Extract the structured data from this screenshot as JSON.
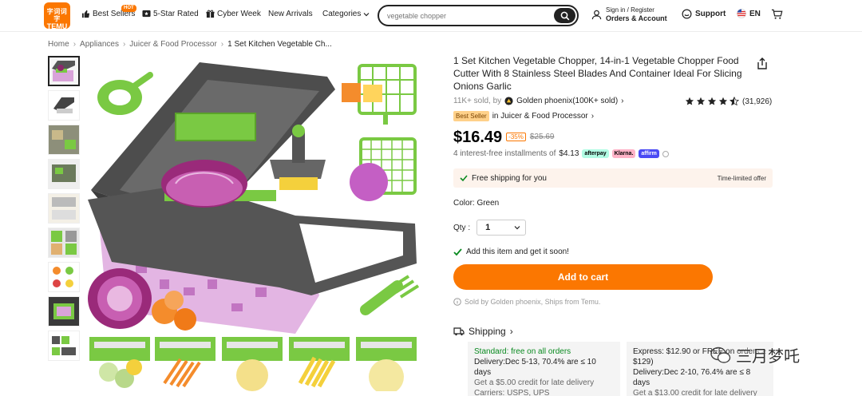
{
  "header": {
    "logo_line1": "字词词字",
    "logo_line2": "TEMU",
    "nav": {
      "best_sellers": "Best Sellers",
      "hot_badge": "HOT",
      "five_star": "5-Star Rated",
      "cyber_week": "Cyber Week",
      "new_arrivals": "New Arrivals",
      "categories": "Categories"
    },
    "search_placeholder": "vegetable chopper",
    "signin_line1": "Sign in / Register",
    "signin_line2": "Orders & Account",
    "support": "Support",
    "language": "EN"
  },
  "breadcrumb": {
    "home": "Home",
    "appliances": "Appliances",
    "juicer": "Juicer & Food Processor",
    "current": "1 Set Kitchen Vegetable Ch..."
  },
  "product": {
    "title": "1 Set Kitchen Vegetable Chopper, 14-in-1 Vegetable Chopper Food Cutter With 8 Stainless Steel Blades And Container Ideal For Slicing Onions Garlic",
    "sold": "11K+ sold, by",
    "seller": "Golden phoenix(100K+ sold)",
    "rating_count": "(31,926)",
    "rating_value": 4.7,
    "best_seller_badge": "Best Seller",
    "best_seller_category": "in Juicer & Food Processor",
    "price": "$16.49",
    "discount": "-35%",
    "old_price": "$25.69",
    "installments_text": "4 interest-free installments of",
    "installment_amount": "$4.13",
    "afterpay": "afterpay",
    "klarna": "Klarna.",
    "affirm": "affirm",
    "free_shipping": "Free shipping for you",
    "time_limited": "Time-limited offer",
    "color_label": "Color: Green",
    "qty_label": "Qty :",
    "qty_value": "1",
    "added_msg": "Add this item and get it soon!",
    "add_to_cart": "Add to cart",
    "sold_by": "Sold by Golden phoenix, Ships from Temu.",
    "shipping_head": "Shipping"
  },
  "shipping": {
    "standard_title": "Standard: free on all orders",
    "standard_delivery": "Delivery:Dec 5-13, 70.4% are ≤ 10 days",
    "standard_credit": "Get a $5.00 credit for late delivery",
    "standard_extra": "Carriers: USPS, UPS",
    "express_title": "Express: $12.90 or FREE on orders ≥ $129)",
    "express_delivery": "Delivery:Dec 2-10, 76.4% are ≤ 8 days",
    "express_credit": "Get a $13.00 credit for late delivery"
  },
  "watermark": "三月梦吒",
  "colors": {
    "brand": "#fb7701",
    "green": "#0a8a20",
    "chopper_green": "#7ac943",
    "chopper_grey": "#555555"
  }
}
